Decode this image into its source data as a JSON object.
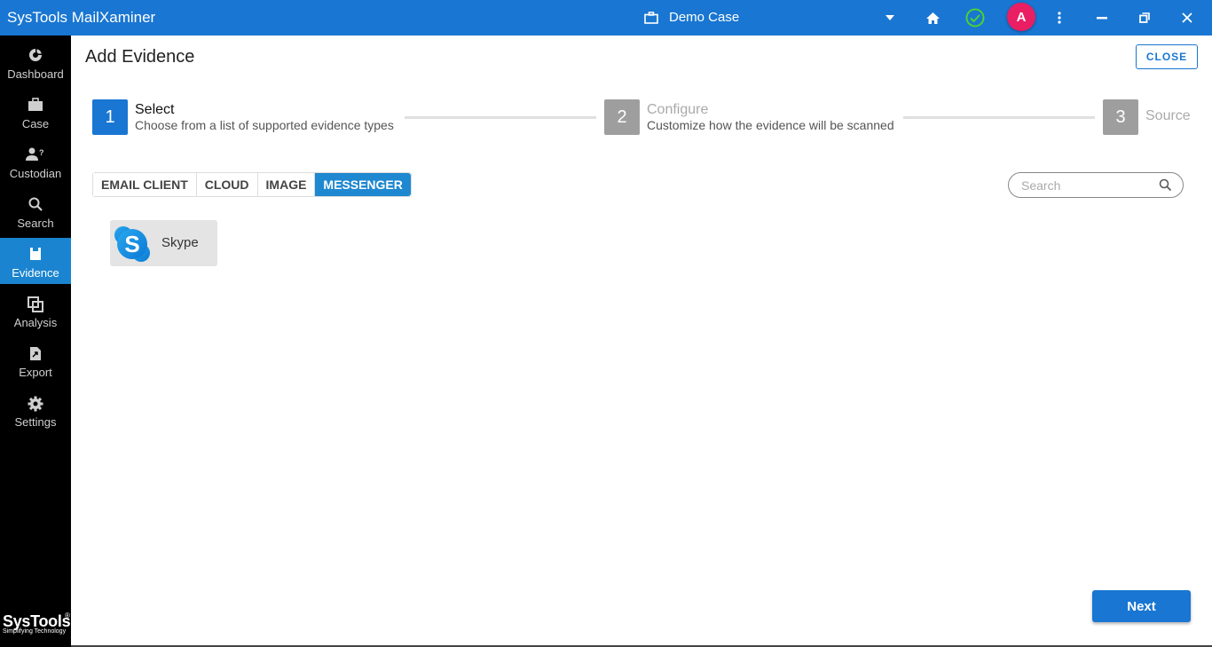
{
  "app": {
    "title": "SysTools MailXaminer"
  },
  "topbar": {
    "case_name": "Demo Case",
    "avatar_initial": "A",
    "icons": [
      "briefcase-icon",
      "dropdown-arrow-icon",
      "home-icon",
      "status-check-icon",
      "more-vert-icon",
      "minimize-icon",
      "restore-icon",
      "close-icon"
    ],
    "status_color": "#4cd137",
    "avatar_color": "#e91e63"
  },
  "sidebar": {
    "items": [
      {
        "label": "Dashboard",
        "icon": "dashboard-icon",
        "active": false
      },
      {
        "label": "Case",
        "icon": "case-icon",
        "active": false
      },
      {
        "label": "Custodian",
        "icon": "custodian-icon",
        "active": false
      },
      {
        "label": "Search",
        "icon": "search-icon",
        "active": false
      },
      {
        "label": "Evidence",
        "icon": "evidence-icon",
        "active": true
      },
      {
        "label": "Analysis",
        "icon": "analysis-icon",
        "active": false
      },
      {
        "label": "Export",
        "icon": "export-icon",
        "active": false
      },
      {
        "label": "Settings",
        "icon": "settings-icon",
        "active": false
      }
    ],
    "logo": {
      "name": "SysTools",
      "tagline": "Simplifying Technology",
      "reg": "®"
    }
  },
  "page": {
    "title": "Add Evidence",
    "close_label": "CLOSE",
    "next_label": "Next"
  },
  "stepper": {
    "steps": [
      {
        "number": "1",
        "title": "Select",
        "description": "Choose from a list of supported evidence types",
        "active": true
      },
      {
        "number": "2",
        "title": "Configure",
        "description": "Customize how the evidence will be scanned",
        "active": false
      },
      {
        "number": "3",
        "title": "Source",
        "description": "",
        "active": false
      }
    ]
  },
  "tabs": {
    "items": [
      "EMAIL CLIENT",
      "CLOUD",
      "IMAGE",
      "MESSENGER"
    ],
    "active": "MESSENGER"
  },
  "search": {
    "placeholder": "Search",
    "value": ""
  },
  "evidence_types": [
    {
      "label": "Skype",
      "icon": "skype-icon"
    }
  ],
  "colors": {
    "accent": "#1976d2",
    "active_tab": "#1e88d0",
    "inactive_step": "#9e9e9e"
  }
}
